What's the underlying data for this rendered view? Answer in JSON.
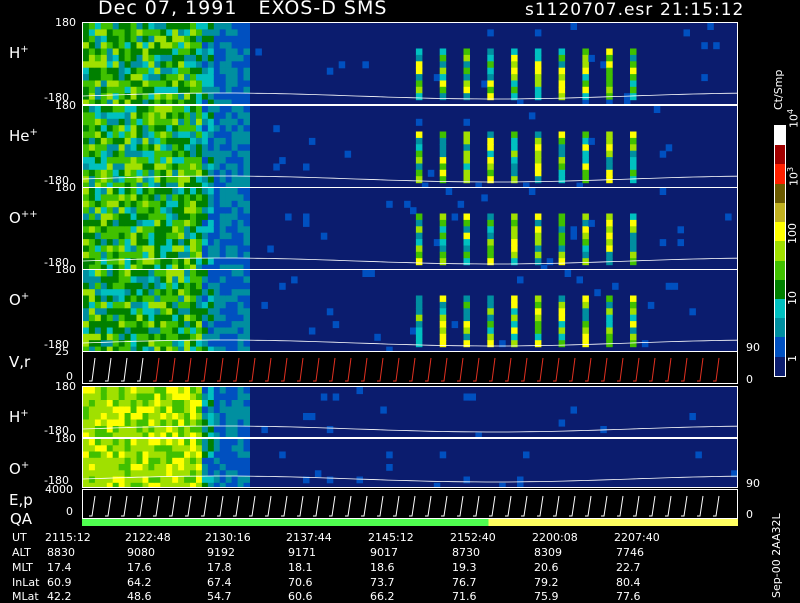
{
  "header": {
    "title": "Dec 07, 1991   EXOS-D SMS",
    "file": "s1120707.esr",
    "time": "21:15:12"
  },
  "panels": [
    {
      "id": "h1",
      "label": "H",
      "sup": "+",
      "top_tick": "180",
      "bottom_tick": "-180"
    },
    {
      "id": "he",
      "label": "He",
      "sup": "+",
      "top_tick": "180",
      "bottom_tick": "-180"
    },
    {
      "id": "o2",
      "label": "O",
      "sup": "++",
      "top_tick": "180",
      "bottom_tick": "-180"
    },
    {
      "id": "o1",
      "label": "O",
      "sup": "+",
      "top_tick": "180",
      "bottom_tick": "-180",
      "right_tick": "90"
    },
    {
      "id": "vr",
      "label": "V,r",
      "sup": "",
      "top_tick": "25",
      "bottom_tick": "0",
      "right_tick": "0"
    },
    {
      "id": "h2",
      "label": "H",
      "sup": "+",
      "top_tick": "180",
      "bottom_tick": "-180"
    },
    {
      "id": "o3",
      "label": "O",
      "sup": "+",
      "top_tick": "180",
      "bottom_tick": "-180",
      "right_tick": "90"
    },
    {
      "id": "ep",
      "label": "E,p",
      "sup": "",
      "top_tick": "4000",
      "bottom_tick": "0",
      "right_tick": "0"
    }
  ],
  "qa_label": "QA",
  "colorbar": {
    "unit": "Ct/Smp",
    "labels": [
      {
        "base": "10",
        "exp": "4"
      },
      {
        "base": "10",
        "exp": "3"
      },
      {
        "base": "100",
        "exp": ""
      },
      {
        "base": "10",
        "exp": ""
      },
      {
        "base": "1",
        "exp": ""
      }
    ],
    "colors": [
      "#ffffff",
      "#a00000",
      "#ff2000",
      "#6b5a00",
      "#c0b020",
      "#ffff00",
      "#a0e000",
      "#40c000",
      "#008000",
      "#00c0c0",
      "#008fa0",
      "#0050c0",
      "#0b1c6e"
    ]
  },
  "side_note": "Sep-00  2AA32L",
  "table": {
    "row_labels": [
      "UT",
      "ALT",
      "MLT",
      "InLat",
      "MLat"
    ],
    "columns": [
      [
        "2115:12",
        "8830",
        "17.4",
        "60.9",
        "42.2"
      ],
      [
        "2122:48",
        "9080",
        "17.6",
        "64.2",
        "48.6"
      ],
      [
        "2130:16",
        "9192",
        "17.8",
        "67.4",
        "54.7"
      ],
      [
        "2137:44",
        "9171",
        "18.1",
        "70.6",
        "60.6"
      ],
      [
        "2145:12",
        "9017",
        "18.6",
        "73.7",
        "66.2"
      ],
      [
        "2152:40",
        "8730",
        "19.3",
        "76.7",
        "71.6"
      ],
      [
        "2200:08",
        "8309",
        "20.6",
        "79.2",
        "75.9"
      ],
      [
        "2207:40",
        "7746",
        "22.7",
        "80.4",
        "77.6"
      ]
    ]
  },
  "chart_data": {
    "type": "heatmap",
    "title": "Dec 07, 1991   EXOS-D SMS",
    "x": [
      "2115:12",
      "2122:48",
      "2130:16",
      "2137:44",
      "2145:12",
      "2152:40",
      "2200:08",
      "2207:40"
    ],
    "colorbar_unit": "Ct/Smp",
    "colorbar_range": [
      1,
      10000
    ],
    "colorbar_scale": "log",
    "panels": [
      {
        "name": "H+",
        "ylim": [
          -180,
          180
        ]
      },
      {
        "name": "He+",
        "ylim": [
          -180,
          180
        ]
      },
      {
        "name": "O++",
        "ylim": [
          -180,
          180
        ]
      },
      {
        "name": "O+",
        "ylim": [
          -180,
          180
        ]
      },
      {
        "name": "V,r",
        "ylim": [
          0,
          25
        ]
      },
      {
        "name": "H+",
        "ylim": [
          -180,
          180
        ]
      },
      {
        "name": "O+",
        "ylim": [
          -180,
          180
        ]
      },
      {
        "name": "E,p",
        "ylim": [
          0,
          4000
        ]
      }
    ]
  }
}
